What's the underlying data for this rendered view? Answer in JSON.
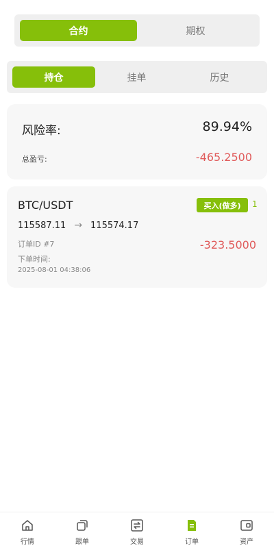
{
  "top_tabs": [
    {
      "label": "合约",
      "active": true
    },
    {
      "label": "期权",
      "active": false
    }
  ],
  "sub_tabs": [
    {
      "label": "持仓",
      "active": true
    },
    {
      "label": "挂单",
      "active": false
    },
    {
      "label": "历史",
      "active": false
    }
  ],
  "risk": {
    "risk_label": "风险率:",
    "risk_value": "89.94%",
    "pnl_label": "总盈亏:",
    "pnl_value": "-465.2500"
  },
  "order": {
    "pair": "BTC/USDT",
    "side_badge": "买入(做多)",
    "leverage": "1",
    "open_price": "115587.11",
    "arrow": "→",
    "current_price": "115574.17",
    "order_id": "订单ID #7",
    "time_label": "下单时间:",
    "time_value": "2025-08-01 04:38:06",
    "pnl": "-323.5000"
  },
  "tabbar": [
    {
      "label": "行情",
      "icon": "home-icon"
    },
    {
      "label": "跟单",
      "icon": "copy-icon"
    },
    {
      "label": "交易",
      "icon": "exchange-icon"
    },
    {
      "label": "订单",
      "icon": "order-icon",
      "active": true
    },
    {
      "label": "资产",
      "icon": "wallet-icon"
    }
  ],
  "colors": {
    "accent": "#86bf0a",
    "negative": "#e05a5a"
  }
}
